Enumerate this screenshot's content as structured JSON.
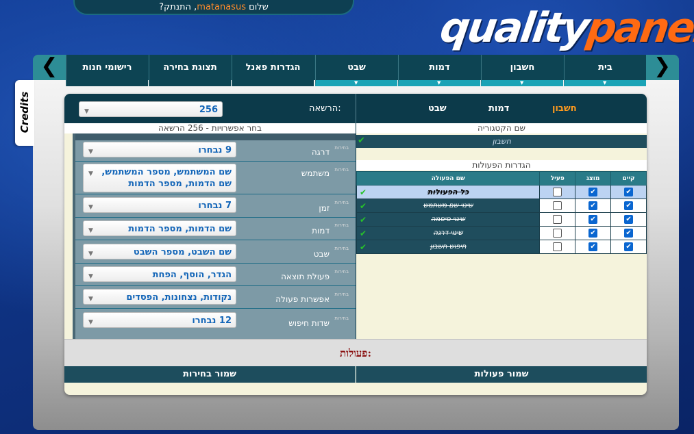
{
  "header": {
    "greeting_prefix": "שלום",
    "username": "matanasus",
    "greeting_suffix": ", התנתק?"
  },
  "logo": {
    "part1": "quality",
    "part2": "panel"
  },
  "nav": {
    "tabs": [
      {
        "label": "בית",
        "dropdown": true
      },
      {
        "label": "חשבון",
        "dropdown": true
      },
      {
        "label": "דמות",
        "dropdown": true
      },
      {
        "label": "שבט",
        "dropdown": true
      },
      {
        "label": "הגדרות פאנל",
        "dropdown": false
      },
      {
        "label": "תצוגת בחירה",
        "dropdown": false
      },
      {
        "label": "רישומי חנות",
        "dropdown": false
      }
    ],
    "left_arrow": "❮",
    "right_arrow": "❮"
  },
  "credits": "Credits",
  "panel": {
    "categories": [
      "חשבון",
      "דמות",
      "שבט"
    ],
    "active_category": "חשבון",
    "license_label": "הרשאה:",
    "license_value": "256",
    "left_subhead": "בחר אפשרויות - 256 הרשאה",
    "right_subhead": "שם הקטגוריה",
    "category_name": "חשבון",
    "options_label": "בחירות",
    "options": [
      {
        "name": "דרגה",
        "value": "9 נבחרו"
      },
      {
        "name": "משתמש",
        "value": "שם המשתמש, מספר המשתמש, שם הדמות, מספר הדמות"
      },
      {
        "name": "זמן",
        "value": "7 נבחרו"
      },
      {
        "name": "דמות",
        "value": "שם הדמות, מספר הדמות"
      },
      {
        "name": "שבט",
        "value": "שם השבט, מספר השבט"
      },
      {
        "name": "פעולת תוצאה",
        "value": "הגדר, הוסף, הפחת"
      },
      {
        "name": "אפשרות פעולה",
        "value": "נקודות, נצחונות, הפסדים"
      },
      {
        "name": "שדות חיפוש",
        "value": "12 נבחרו"
      }
    ],
    "actions_title": "הגדרות הפעולות",
    "table_headers": {
      "exists": "קיים",
      "shown": "מוצג",
      "active": "פעיל",
      "action_name": "שם הפעולה"
    },
    "all_actions": "כל הפעולות",
    "actions": [
      {
        "name": "שינוי שם משתמש",
        "exists": true,
        "shown": true,
        "active": false
      },
      {
        "name": "שינוי סיסמה",
        "exists": true,
        "shown": true,
        "active": false
      },
      {
        "name": "שינוי דרגה",
        "exists": true,
        "shown": true,
        "active": false
      },
      {
        "name": "חיפוש חשבון",
        "exists": true,
        "shown": true,
        "active": false
      }
    ],
    "footer_label": "פעולות:",
    "save_selections": "שמור בחירות",
    "save_actions": "שמור פעולות"
  }
}
